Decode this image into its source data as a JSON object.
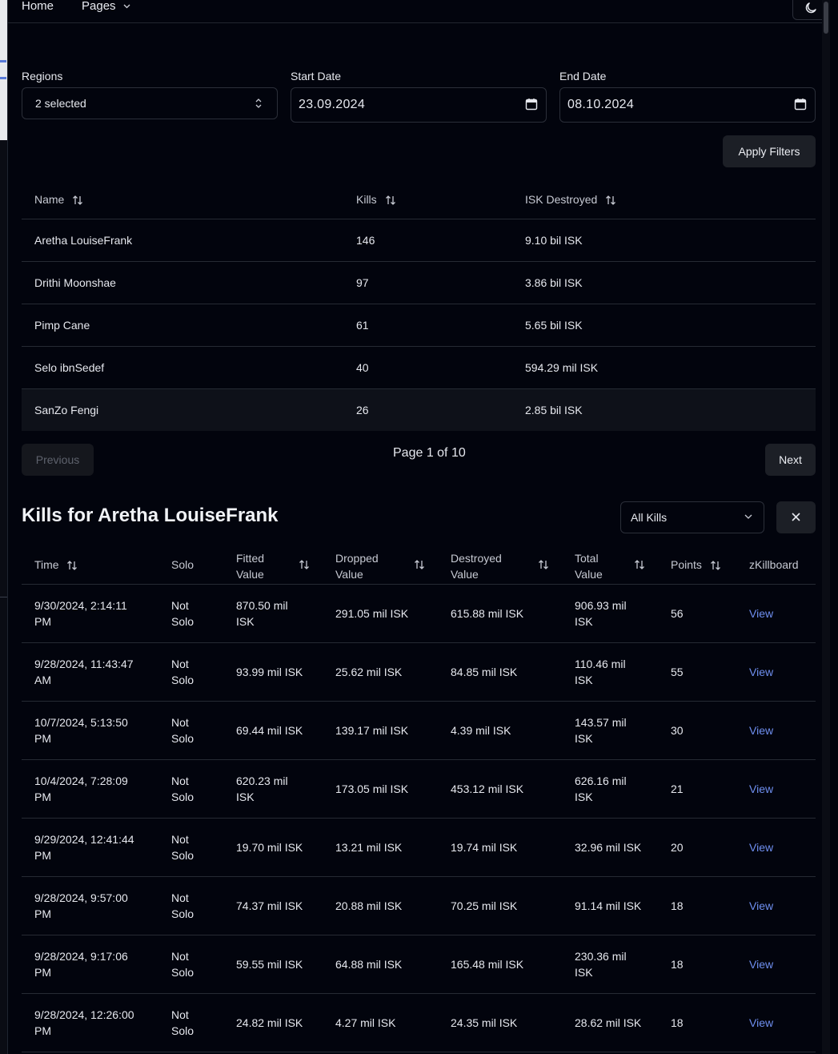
{
  "nav": {
    "home": "Home",
    "pages": "Pages"
  },
  "filters": {
    "regions_label": "Regions",
    "regions_value": "2 selected",
    "start_label": "Start Date",
    "start_value": "23.09.2024",
    "end_label": "End Date",
    "end_value": "08.10.2024",
    "apply_label": "Apply Filters"
  },
  "leaderboard": {
    "headers": [
      "Name",
      "Kills",
      "ISK Destroyed"
    ],
    "rows": [
      {
        "name": "Aretha LouiseFrank",
        "kills": "146",
        "isk": "9.10 bil ISK"
      },
      {
        "name": "Drithi Moonshae",
        "kills": "97",
        "isk": "3.86 bil ISK"
      },
      {
        "name": "Pimp Cane",
        "kills": "61",
        "isk": "5.65 bil ISK"
      },
      {
        "name": "Selo ibnSedef",
        "kills": "40",
        "isk": "594.29 mil ISK"
      },
      {
        "name": "SanZo Fengi",
        "kills": "26",
        "isk": "2.85 bil ISK"
      }
    ],
    "previous_label": "Previous",
    "page_info": "Page 1 of 10",
    "next_label": "Next"
  },
  "kills": {
    "title": "Kills for Aretha LouiseFrank",
    "filter_value": "All Kills",
    "headers": {
      "time": "Time",
      "solo": "Solo",
      "fitted_1": "Fitted",
      "fitted_2": "Value",
      "dropped_1": "Dropped",
      "dropped_2": "Value",
      "destroyed_1": "Destroyed",
      "destroyed_2": "Value",
      "total_1": "Total",
      "total_2": "Value",
      "points": "Points",
      "zkb": "zKillboard"
    },
    "rows": [
      {
        "time1": "9/30/2024, 2:14:11",
        "time2": "PM",
        "solo1": "Not",
        "solo2": "Solo",
        "fit1": "870.50 mil",
        "fit2": "ISK",
        "drop1": "291.05 mil ISK",
        "drop2": "",
        "dest1": "615.88 mil ISK",
        "dest2": "",
        "tot1": "906.93 mil",
        "tot2": "ISK",
        "points": "56",
        "link": "View"
      },
      {
        "time1": "9/28/2024, 11:43:47",
        "time2": "AM",
        "solo1": "Not",
        "solo2": "Solo",
        "fit1": "93.99 mil ISK",
        "fit2": "",
        "drop1": "25.62 mil ISK",
        "drop2": "",
        "dest1": "84.85 mil ISK",
        "dest2": "",
        "tot1": "110.46 mil",
        "tot2": "ISK",
        "points": "55",
        "link": "View"
      },
      {
        "time1": "10/7/2024, 5:13:50",
        "time2": "PM",
        "solo1": "Not",
        "solo2": "Solo",
        "fit1": "69.44 mil ISK",
        "fit2": "",
        "drop1": "139.17 mil ISK",
        "drop2": "",
        "dest1": "4.39 mil ISK",
        "dest2": "",
        "tot1": "143.57 mil",
        "tot2": "ISK",
        "points": "30",
        "link": "View"
      },
      {
        "time1": "10/4/2024, 7:28:09",
        "time2": "PM",
        "solo1": "Not",
        "solo2": "Solo",
        "fit1": "620.23 mil",
        "fit2": "ISK",
        "drop1": "173.05 mil ISK",
        "drop2": "",
        "dest1": "453.12 mil ISK",
        "dest2": "",
        "tot1": "626.16 mil",
        "tot2": "ISK",
        "points": "21",
        "link": "View"
      },
      {
        "time1": "9/29/2024, 12:41:44",
        "time2": "PM",
        "solo1": "Not",
        "solo2": "Solo",
        "fit1": "19.70 mil ISK",
        "fit2": "",
        "drop1": "13.21 mil ISK",
        "drop2": "",
        "dest1": "19.74 mil ISK",
        "dest2": "",
        "tot1": "32.96 mil ISK",
        "tot2": "",
        "points": "20",
        "link": "View"
      },
      {
        "time1": "9/28/2024, 9:57:00",
        "time2": "PM",
        "solo1": "Not",
        "solo2": "Solo",
        "fit1": "74.37 mil ISK",
        "fit2": "",
        "drop1": "20.88 mil ISK",
        "drop2": "",
        "dest1": "70.25 mil ISK",
        "dest2": "",
        "tot1": "91.14 mil ISK",
        "tot2": "",
        "points": "18",
        "link": "View"
      },
      {
        "time1": "9/28/2024, 9:17:06",
        "time2": "PM",
        "solo1": "Not",
        "solo2": "Solo",
        "fit1": "59.55 mil ISK",
        "fit2": "",
        "drop1": "64.88 mil ISK",
        "drop2": "",
        "dest1": "165.48 mil ISK",
        "dest2": "",
        "tot1": "230.36 mil",
        "tot2": "ISK",
        "points": "18",
        "link": "View"
      },
      {
        "time1": "9/28/2024, 12:26:00",
        "time2": "PM",
        "solo1": "Not",
        "solo2": "Solo",
        "fit1": "24.82 mil ISK",
        "fit2": "",
        "drop1": "4.27 mil ISK",
        "drop2": "",
        "dest1": "24.35 mil ISK",
        "dest2": "",
        "tot1": "28.62 mil ISK",
        "tot2": "",
        "points": "18",
        "link": "View"
      }
    ]
  },
  "colors": {
    "background": "#02040d",
    "link": "#6f8ff0",
    "button": "#1c1f26"
  }
}
